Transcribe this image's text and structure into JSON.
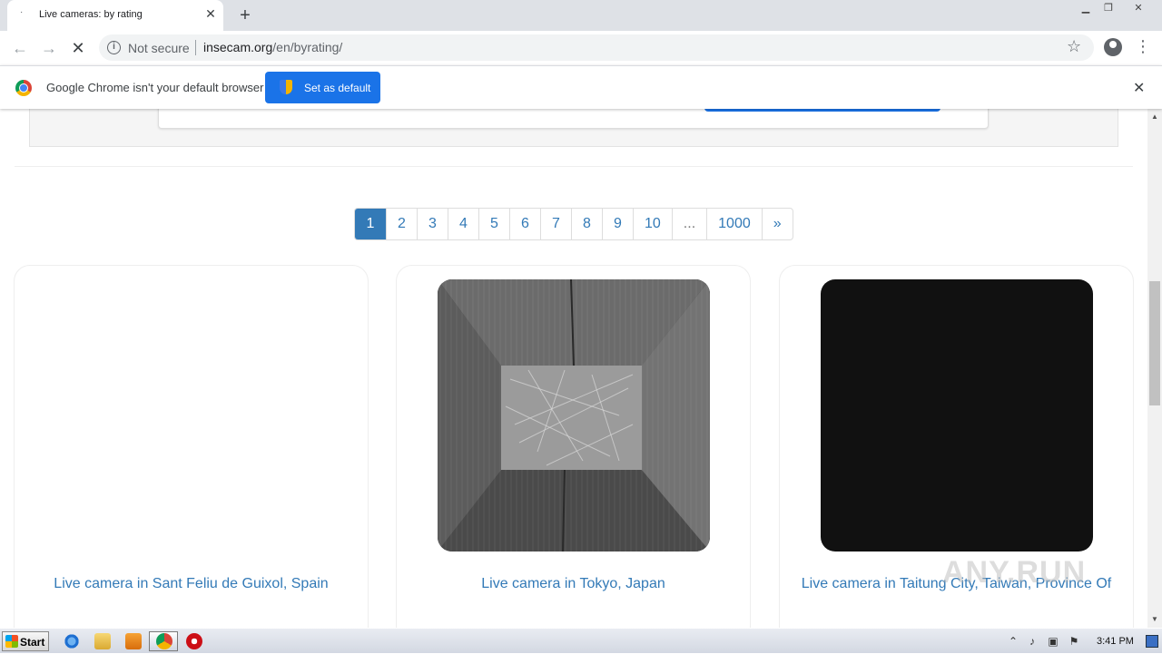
{
  "browser": {
    "tab_title": "Live cameras: by rating",
    "tab_favicon": "·",
    "new_tab_label": "+",
    "close_tab_label": "✕",
    "security_label": "Not secure",
    "url_host": "insecam.org",
    "url_path": "/en/byrating/",
    "window_controls": [
      "minimize-icon",
      "restore-icon",
      "close-icon"
    ]
  },
  "infobar": {
    "message": "Google Chrome isn't your default browser",
    "button_label": "Set as default",
    "close_label": "✕"
  },
  "pagination": {
    "pages": [
      "1",
      "2",
      "3",
      "4",
      "5",
      "6",
      "7",
      "8",
      "9",
      "10",
      "...",
      "1000",
      "»"
    ],
    "active": "1"
  },
  "cameras": [
    {
      "caption": "Live camera in Sant Feliu de Guixol, Spain",
      "thumbnail": "blank"
    },
    {
      "caption": "Live camera in Tokyo, Japan",
      "thumbnail": "wooden-box-interior"
    },
    {
      "caption": "Live camera in Taitung City, Taiwan, Province Of",
      "thumbnail": "black"
    }
  ],
  "watermark": "ANY.RUN",
  "taskbar": {
    "start_label": "Start",
    "clock": "3:41 PM",
    "pinned": [
      "internet-explorer-icon",
      "explorer-icon",
      "media-player-icon",
      "chrome-icon",
      "opera-icon"
    ]
  },
  "colors": {
    "link": "#337ab7",
    "chrome_blue": "#1a73e8",
    "tab_strip": "#dee1e6"
  }
}
